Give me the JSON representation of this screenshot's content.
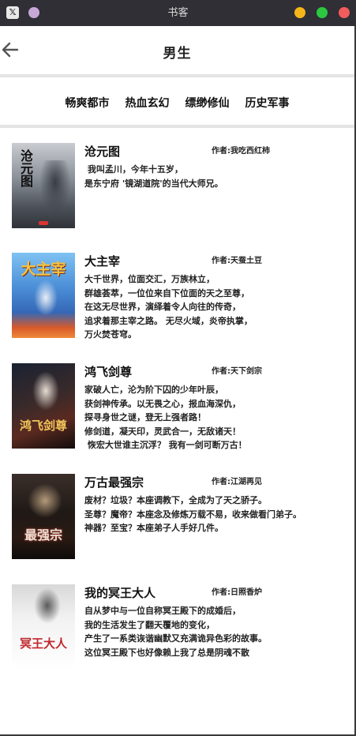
{
  "window": {
    "title": "书客",
    "close_color": "#f25c5c",
    "minimize_color": "#f5b619",
    "maximize_color": "#2bc840"
  },
  "header": {
    "title": "男生"
  },
  "categories": [
    "畅爽都市",
    "热血玄幻",
    "缥缈修仙",
    "历史军事"
  ],
  "books": [
    {
      "title": "沧元图",
      "author": "作者:我吃西红柿",
      "desc": " 我叫孟川，今年十五岁，\n是东宁府 '镜湖道院'的当代大师兄。",
      "cover_text": "沧元图",
      "cover_bg": "#6a7078"
    },
    {
      "title": "大主宰",
      "author": "作者:天蚕土豆",
      "desc": "大千世界，位面交汇，万族林立，\n群雄荟萃，一位位来自下位面的天之至尊，\n在这无尽世界，演绎着令人向往的传奇，\n追求着那主宰之路。 无尽火域，炎帝执掌，\n万火焚苍穹。",
      "cover_text": "大主宰",
      "cover_bg": "#4f8fd6"
    },
    {
      "title": "鸿飞剑尊",
      "author": "作者:天下剑宗",
      "desc": "家破人亡，沦为阶下囚的少年叶辰，\n获剑神传承。以无畏之心，报血海深仇，\n探寻身世之谜，登无上强者路！\n修剑道，凝天印，灵武合一，无敌诸天！\n 恢宏大世谁主沉浮？ 我有一剑可断万古！",
      "cover_text": "鸿飞剑尊",
      "cover_bg": "#2a1e1c"
    },
    {
      "title": "万古最强宗",
      "author": "作者:江湖再见",
      "desc": "废材？垃圾？本座调教下，全成为了天之骄子。\n圣尊？魔帝？本座念及修炼万载不易，收来做看门弟子。\n神器？至宝？本座弟子人手好几件。",
      "cover_text": "最强宗",
      "cover_bg": "#1c1717"
    },
    {
      "title": "我的冥王大人",
      "author": "作者:日照香炉",
      "desc": "自从梦中与一位自称冥王殿下的成婚后，\n我的生活发生了翻天覆地的变化，\n产生了一系类诙谐幽默又充满诡异色彩的故事。\n这位冥王殿下也好像赖上我了总是阴魂不散",
      "cover_text": "冥王大人",
      "cover_bg": "#eaeaea"
    }
  ]
}
